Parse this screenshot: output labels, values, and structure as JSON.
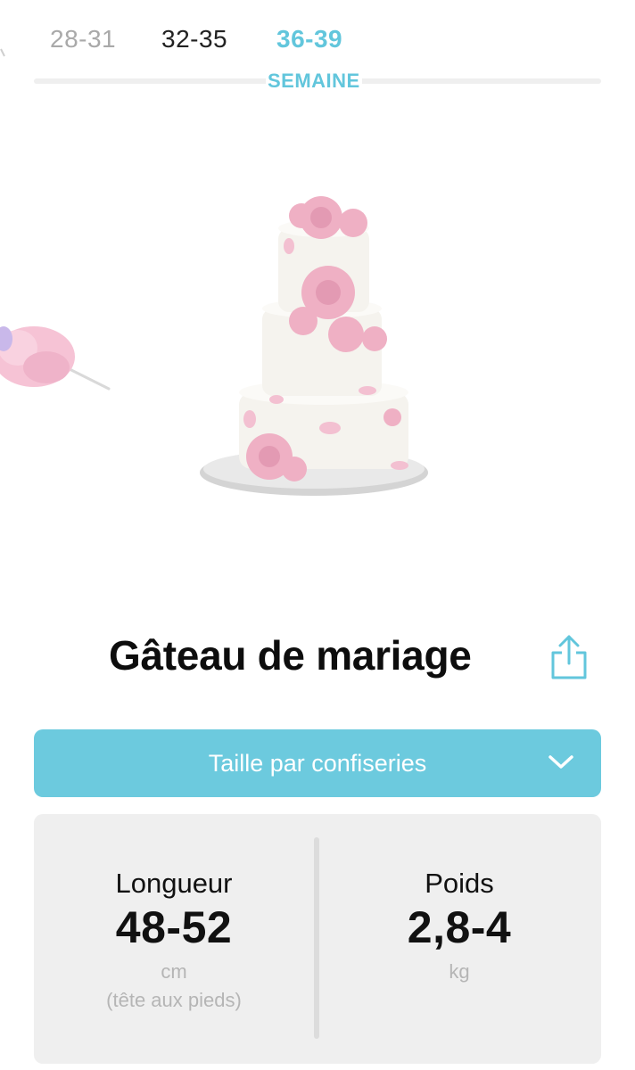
{
  "week_selector": {
    "tabs": [
      {
        "label": "28-31",
        "state": "faded"
      },
      {
        "label": "32-35",
        "state": "normal"
      },
      {
        "label": "36-39",
        "state": "active"
      }
    ],
    "caption": "SEMAINE",
    "accent_color": "#62c6dc"
  },
  "illustration": {
    "main_icon": "wedding-cake-illustration",
    "side_icon": "cotton-candy-illustration"
  },
  "item": {
    "title": "Gâteau de mariage",
    "share_icon": "share-icon"
  },
  "size_dropdown": {
    "label": "Taille par confiseries",
    "icon": "chevron-down-icon",
    "color": "#6ccade"
  },
  "stats": {
    "length": {
      "label": "Longueur",
      "value": "48-52",
      "unit": "cm",
      "note": "(tête aux pieds)"
    },
    "weight": {
      "label": "Poids",
      "value": "2,8-4",
      "unit": "kg"
    }
  }
}
